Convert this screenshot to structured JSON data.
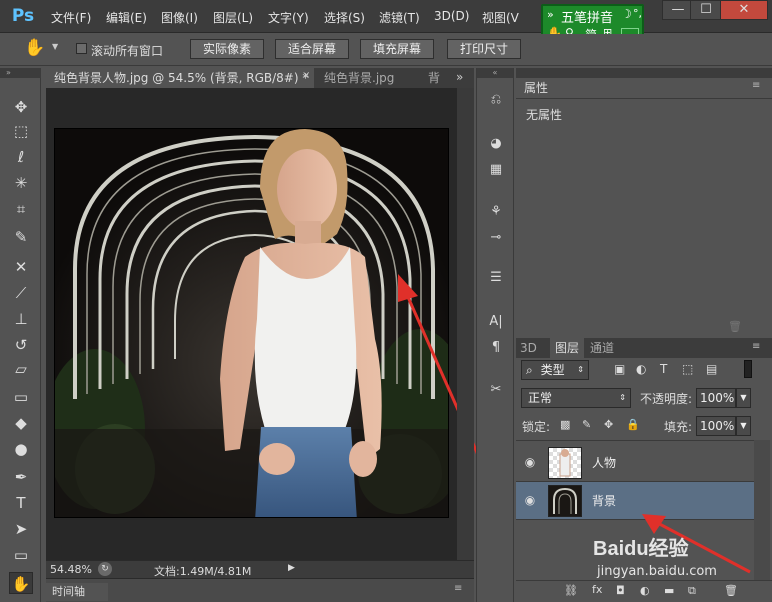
{
  "app": {
    "logo": "Ps"
  },
  "menubar": {
    "items": [
      "文件(F)",
      "编辑(E)",
      "图像(I)",
      "图层(L)",
      "文字(Y)",
      "选择(S)",
      "滤镜(T)",
      "3D(D)",
      "视图(V"
    ],
    "window_controls": [
      "—",
      "☐",
      "✕"
    ]
  },
  "ime": {
    "name": "五笔拼音",
    "row2": "简"
  },
  "options_bar": {
    "scroll_all_label": "滚动所有窗口",
    "scroll_all_checked": false,
    "buttons": [
      "实际像素",
      "适合屏幕",
      "填充屏幕",
      "打印尺寸"
    ]
  },
  "tools": [
    "move-icon",
    "marquee-icon",
    "lasso-icon",
    "magic-wand-icon",
    "crop-icon",
    "eyedropper-icon",
    "healing-icon",
    "brush-icon",
    "stamp-icon",
    "history-brush-icon",
    "eraser-icon",
    "gradient-icon",
    "blur-icon",
    "dodge-icon",
    "pen-icon",
    "type-icon",
    "path-select-icon",
    "shape-icon",
    "hand-icon"
  ],
  "document_tabs": [
    {
      "label": "纯色背景人物.jpg @ 54.5% (背景, RGB/8#) *"
    },
    {
      "label": "纯色背景.jpg"
    },
    {
      "label": "背"
    }
  ],
  "status": {
    "zoom": "54.48%",
    "doc": "文档:1.49M/4.81M"
  },
  "timeline": {
    "label": "时间轴"
  },
  "properties": {
    "tab": "属性",
    "content": "无属性"
  },
  "layers_panel": {
    "tabs": [
      "3D",
      "图层",
      "通道"
    ],
    "active_tab": "图层",
    "filter_kind": "类型",
    "blend_mode": "正常",
    "opacity_label": "不透明度:",
    "opacity_value": "100%",
    "lock_label": "锁定:",
    "fill_label": "填充:",
    "fill_value": "100%",
    "layers": [
      {
        "name": "人物",
        "selected": false
      },
      {
        "name": "背景",
        "selected": true
      }
    ],
    "bottom_icons": [
      "link-icon",
      "fx-icon",
      "mask-icon",
      "adjustment-icon",
      "group-icon",
      "new-layer-icon",
      "trash-icon"
    ]
  },
  "watermark": {
    "brand": "Baidu经验",
    "url": "jingyan.baidu.com"
  },
  "colors": {
    "selected_layer": "#5b6f85",
    "ime_green": "#1d8a2a",
    "arrow_red": "#e0302a"
  }
}
